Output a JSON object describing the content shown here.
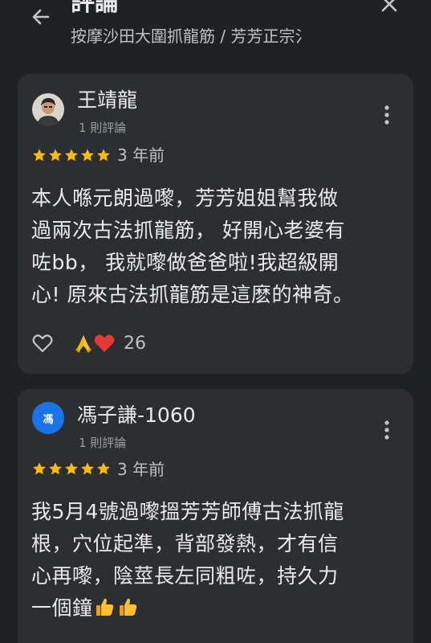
{
  "header": {
    "title": "評論",
    "subtitle": "按摩沙田大圍抓龍筋 / 芳芳正宗氵"
  },
  "reviews": [
    {
      "name": "王靖龍",
      "review_count": "1 則評論",
      "rating": 5,
      "date": "3 年前",
      "text_lines": [
        "本人喺元朗過嚟，芳芳姐姐幫我做",
        "過兩次古法抓龍筋， 好開心老婆有",
        "咗bb， 我就嚟做爸爸啦!我超級開",
        "心! 原來古法抓龍筋是這麽的神奇。"
      ],
      "reaction_count": "26"
    },
    {
      "name": "馮子謙-1060",
      "avatar_initial": "馮",
      "review_count": "1 則評論",
      "rating": 5,
      "date": "3 年前",
      "text_lines": [
        "我5月4號過嚟搵芳芳師傅古法抓龍",
        "根，穴位起準，背部發熱，才有信",
        "心再嚟，陰莖長左同粗咗，持久力",
        "一個鐘"
      ]
    }
  ],
  "colors": {
    "background": "#202124",
    "card": "#2d2e31",
    "star": "#fbbc04",
    "avatar_blue": "#1a73e8"
  }
}
